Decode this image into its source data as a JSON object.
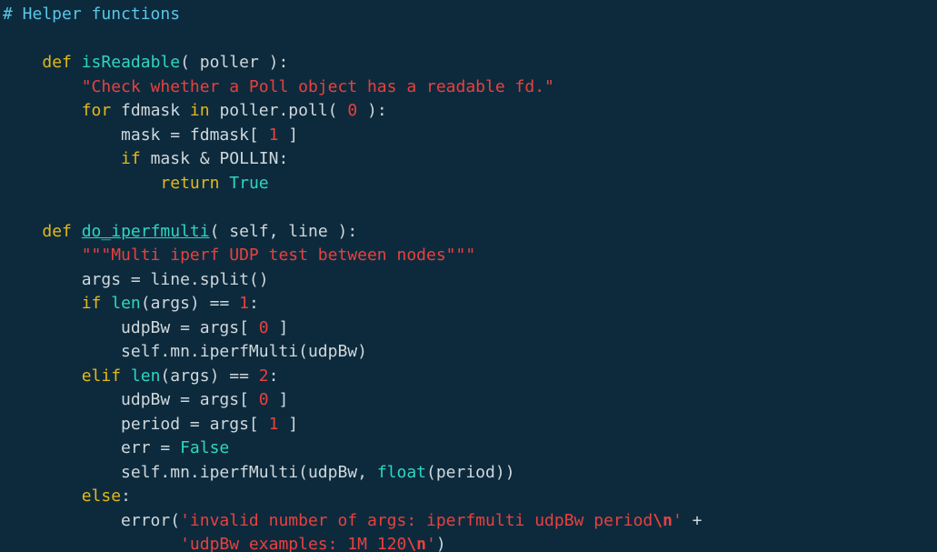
{
  "editor": {
    "language": "python",
    "lines": [
      [
        {
          "t": "# Helper functions",
          "k": "comment"
        }
      ],
      [],
      [
        {
          "t": "    "
        },
        {
          "t": "def",
          "k": "keyword"
        },
        {
          "t": " "
        },
        {
          "t": "isReadable",
          "k": "funcname"
        },
        {
          "t": "( poller ):"
        }
      ],
      [
        {
          "t": "        "
        },
        {
          "t": "\"Check whether a Poll object has a readable fd.\"",
          "k": "string"
        }
      ],
      [
        {
          "t": "        "
        },
        {
          "t": "for",
          "k": "keyword"
        },
        {
          "t": " fdmask "
        },
        {
          "t": "in",
          "k": "keyword"
        },
        {
          "t": " poller.poll( "
        },
        {
          "t": "0",
          "k": "number"
        },
        {
          "t": " ):"
        }
      ],
      [
        {
          "t": "            mask = fdmask[ "
        },
        {
          "t": "1",
          "k": "number"
        },
        {
          "t": " ]"
        }
      ],
      [
        {
          "t": "            "
        },
        {
          "t": "if",
          "k": "keyword"
        },
        {
          "t": " mask & POLLIN:"
        }
      ],
      [
        {
          "t": "                "
        },
        {
          "t": "return",
          "k": "keyword"
        },
        {
          "t": " "
        },
        {
          "t": "True",
          "k": "const"
        }
      ],
      [],
      [
        {
          "t": "    "
        },
        {
          "t": "def",
          "k": "keyword"
        },
        {
          "t": " "
        },
        {
          "t": "do_iperfmulti",
          "k": "funcname"
        },
        {
          "t": "( self, line ):"
        }
      ],
      [
        {
          "t": "        "
        },
        {
          "t": "\"\"\"Multi iperf UDP test between nodes\"\"\"",
          "k": "string"
        }
      ],
      [
        {
          "t": "        args = line.split()"
        }
      ],
      [
        {
          "t": "        "
        },
        {
          "t": "if",
          "k": "keyword"
        },
        {
          "t": " "
        },
        {
          "t": "len",
          "k": "builtin"
        },
        {
          "t": "(args) == "
        },
        {
          "t": "1",
          "k": "number"
        },
        {
          "t": ":"
        }
      ],
      [
        {
          "t": "            udpBw = args[ "
        },
        {
          "t": "0",
          "k": "number"
        },
        {
          "t": " ]"
        }
      ],
      [
        {
          "t": "            self.mn.iperfMulti(udpBw)"
        }
      ],
      [
        {
          "t": "        "
        },
        {
          "t": "elif",
          "k": "keyword"
        },
        {
          "t": " "
        },
        {
          "t": "len",
          "k": "builtin"
        },
        {
          "t": "(args) == "
        },
        {
          "t": "2",
          "k": "number"
        },
        {
          "t": ":"
        }
      ],
      [
        {
          "t": "            udpBw = args[ "
        },
        {
          "t": "0",
          "k": "number"
        },
        {
          "t": " ]"
        }
      ],
      [
        {
          "t": "            period = args[ "
        },
        {
          "t": "1",
          "k": "number"
        },
        {
          "t": " ]"
        }
      ],
      [
        {
          "t": "            err = "
        },
        {
          "t": "False",
          "k": "const"
        }
      ],
      [
        {
          "t": "            self.mn.iperfMulti(udpBw, "
        },
        {
          "t": "float",
          "k": "builtin"
        },
        {
          "t": "(period))"
        }
      ],
      [
        {
          "t": "        "
        },
        {
          "t": "else",
          "k": "keyword"
        },
        {
          "t": ":"
        }
      ],
      [
        {
          "t": "            error("
        },
        {
          "t": "'invalid number of args: iperfmulti udpBw period",
          "k": "string"
        },
        {
          "t": "\\n",
          "k": "escape"
        },
        {
          "t": "'",
          "k": "string"
        },
        {
          "t": " +"
        }
      ],
      [
        {
          "t": "                  "
        },
        {
          "t": "'udpBw examples: 1M 120",
          "k": "string"
        },
        {
          "t": "\\n",
          "k": "escape"
        },
        {
          "t": "'",
          "k": "string"
        },
        {
          "t": ")"
        }
      ]
    ]
  },
  "colors": {
    "background": "#0d2a3d",
    "comment": "#58c7e6",
    "keyword": "#e3b917",
    "funcname": "#2fd6bf",
    "string": "#e8413e",
    "number": "#e8413e",
    "builtin": "#2fd6bf",
    "const": "#2fd6bf",
    "ident": "#cfd8dc"
  }
}
